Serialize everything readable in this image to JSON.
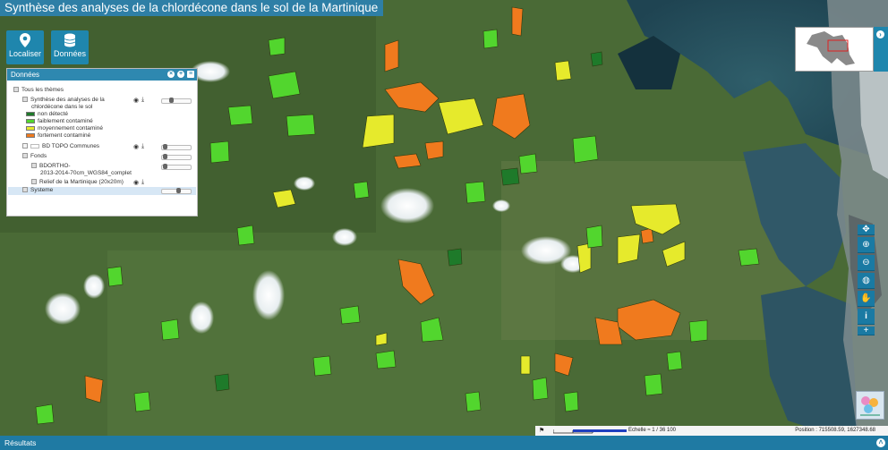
{
  "app": {
    "title": "Synthèse des analyses de la chlordécone dans le sol de la Martinique"
  },
  "toolbar": {
    "localiser_label": "Localiser",
    "donnees_label": "Données"
  },
  "panel": {
    "title": "Données",
    "tree": [
      {
        "label": "Tous les thèmes",
        "checked": true
      },
      {
        "label": "Synthèse des analyses de la",
        "label2": "chlordécone dans le sol",
        "checked": true
      },
      {
        "label": "non détecté",
        "color": "#1e7a2a"
      },
      {
        "label": "faiblement contaminé",
        "color": "#52d62e"
      },
      {
        "label": "moyennement contaminé",
        "color": "#e6ea2c"
      },
      {
        "label": "fortement contaminé",
        "color": "#f07a1e"
      },
      {
        "label": "BD TOPO Communes",
        "checked": false
      },
      {
        "label": "Fonds",
        "checked": true
      },
      {
        "label": "BDORTHO-",
        "label2": "2013-2014-70cm_WGS84_complet",
        "checked": true
      },
      {
        "label": "Relief de la Martinique (20x20m)",
        "checked": true
      },
      {
        "label": "Systeme",
        "checked": true
      }
    ]
  },
  "scale": {
    "label": "Echelle ≈ 1 / 36 100",
    "position": "Position : 715508.59, 1627348.68"
  },
  "results": {
    "label": "Résultats"
  },
  "colors": {
    "accent": "#1f86ad",
    "non_detecte": "#1e7a2a",
    "faible": "#52d62e",
    "moyen": "#e6ea2c",
    "fort": "#f07a1e"
  },
  "icons": [
    "map-pin-icon",
    "database-icon",
    "pan-icon",
    "zoom-in-icon",
    "zoom-out-icon",
    "globe-icon",
    "hand-icon",
    "info-icon",
    "plus-icon",
    "chevron-right-icon"
  ]
}
